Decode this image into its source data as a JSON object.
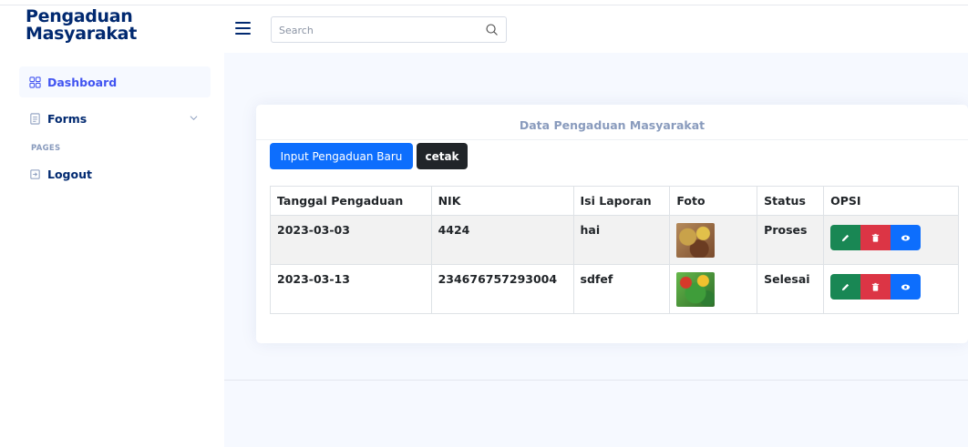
{
  "header": {
    "logo_line1": "Pengaduan",
    "logo_line2": "Masyarakat",
    "search_placeholder": "Search"
  },
  "sidebar": {
    "items": [
      {
        "label": "Dashboard",
        "icon": "grid-icon"
      },
      {
        "label": "Forms",
        "icon": "journal-text-icon"
      },
      {
        "label": "Logout",
        "icon": "box-arrow-icon"
      }
    ],
    "pages_heading": "PAGES"
  },
  "card": {
    "title": "Data Pengaduan Masyarakat",
    "btn_new": "Input Pengaduan Baru",
    "btn_print": "cetak"
  },
  "table": {
    "headers": [
      "Tanggal Pengaduan",
      "NIK",
      "Isi Laporan",
      "Foto",
      "Status",
      "OPSI"
    ],
    "rows": [
      {
        "tanggal": "2023-03-03",
        "nik": "4424",
        "isi": "hai",
        "foto": "food-photo",
        "status": "Proses"
      },
      {
        "tanggal": "2023-03-13",
        "nik": "234676757293004",
        "isi": "sdfef",
        "foto": "vegetables-photo",
        "status": "Selesai"
      }
    ]
  },
  "colors": {
    "brand": "#012970",
    "primary": "#0d6efd",
    "success": "#198754",
    "danger": "#dc3545",
    "dark": "#212529"
  }
}
